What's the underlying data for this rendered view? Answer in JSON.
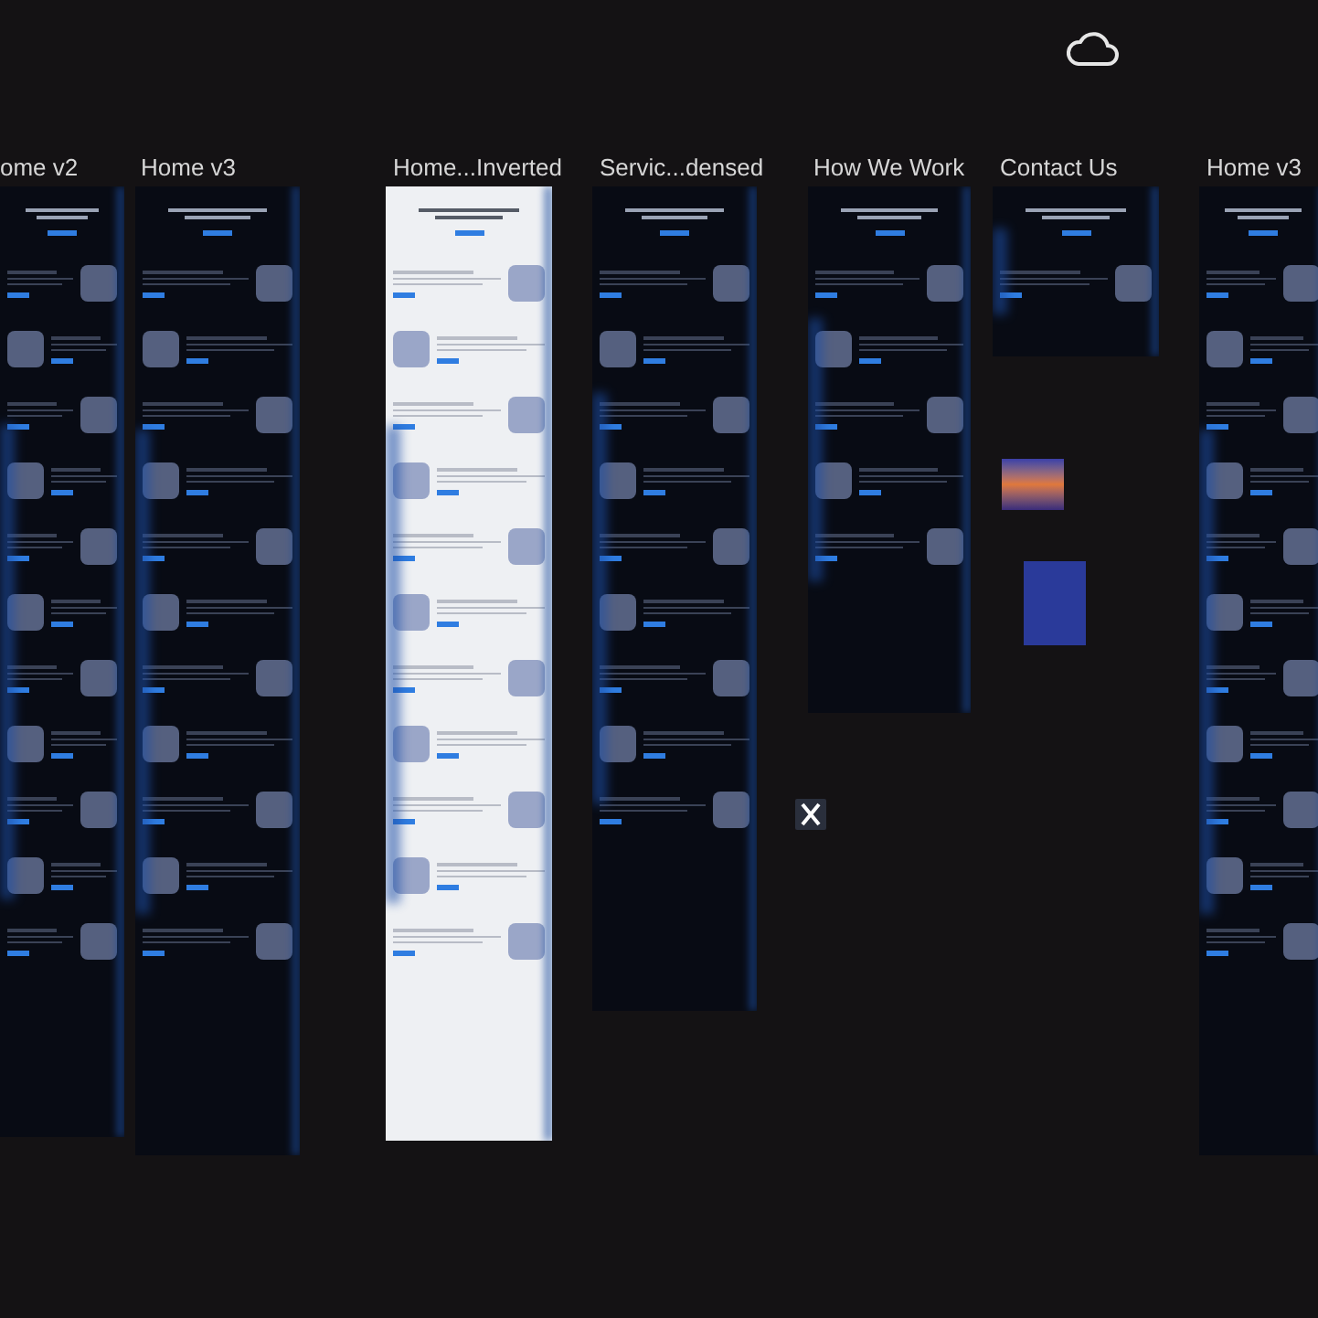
{
  "frames": [
    {
      "title": "ome v2",
      "kind": "dark"
    },
    {
      "title": "Home v3",
      "kind": "dark"
    },
    {
      "title": "Home...Inverted",
      "kind": "light"
    },
    {
      "title": "Servic...densed",
      "kind": "dark"
    },
    {
      "title": "How We Work",
      "kind": "dark"
    },
    {
      "title": "Contact Us",
      "kind": "dark"
    },
    {
      "title": "Home v3",
      "kind": "dark"
    }
  ]
}
